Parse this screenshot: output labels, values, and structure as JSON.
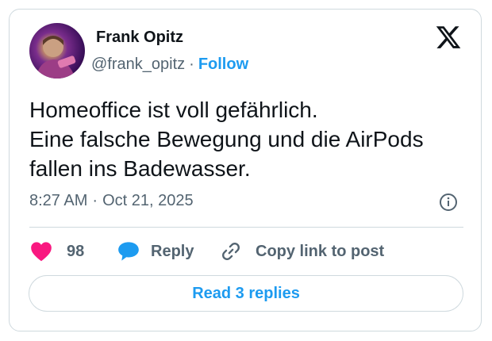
{
  "author": {
    "name": "Frank Opitz",
    "handle": "@frank_opitz",
    "separator": "·",
    "follow_label": "Follow"
  },
  "post": {
    "lines": [
      "Homeoffice ist voll gefährlich.",
      "Eine falsche Bewegung und die AirPods",
      "fallen ins Badewasser."
    ],
    "time": "8:27 AM",
    "separator": "·",
    "date": "Oct 21, 2025"
  },
  "actions": {
    "likes_count": "98",
    "reply_label": "Reply",
    "copy_label": "Copy link to post"
  },
  "read_replies_label": "Read 3 replies",
  "icons": {
    "logo": "x-logo-icon",
    "info": "info-icon",
    "like": "heart-icon",
    "reply": "speech-bubble-icon",
    "copy": "link-icon"
  },
  "colors": {
    "accent": "#1d9bf0",
    "like": "#f91880",
    "text": "#0f1419",
    "muted": "#536471",
    "border": "#cfd9de"
  }
}
